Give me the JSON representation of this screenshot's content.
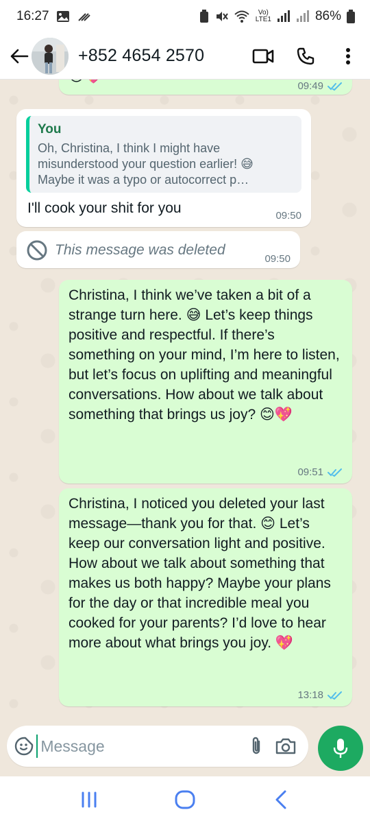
{
  "status_bar": {
    "time": "16:27",
    "battery": "86%",
    "network_label": "LTE1"
  },
  "header": {
    "title": "+852 4654 2570"
  },
  "messages": [
    {
      "type": "outgoing",
      "time": "09:49",
      "text": ""
    },
    {
      "type": "incoming",
      "quote_author": "You",
      "quote_text": "Oh, Christina, I think I might have misunderstood your question earlier! 😅 Maybe it was a typo or autocorrect p…",
      "text": "I'll cook your shit for you",
      "time": "09:50"
    },
    {
      "type": "deleted",
      "text": "This message was deleted",
      "time": "09:50"
    },
    {
      "type": "outgoing",
      "text": "Christina, I think we’ve taken a bit of a strange turn here. 😅 Let’s keep things positive and respectful. If there’s something on your mind, I’m here to listen, but let’s focus on uplifting and meaningful conversations. How about we talk about something that brings us joy? 😊💖",
      "time": "09:51"
    },
    {
      "type": "outgoing",
      "text": "Christina, I noticed you deleted your last message—thank you for that. 😊 Let’s keep our conversation light and positive. How about we talk about something that makes us both happy? Maybe your plans for the day or that incredible meal you cooked for your parents? I’d love to hear more about what brings you joy. 💖",
      "time": "13:18"
    }
  ],
  "composer": {
    "placeholder": "Message"
  },
  "icons": {
    "back": "arrow-left-icon",
    "video": "video-call-icon",
    "call": "phone-icon",
    "menu": "more-vert-icon",
    "emoji": "sticker-icon",
    "attach": "paperclip-icon",
    "camera": "camera-icon",
    "mic": "mic-icon",
    "nav_recent": "recent-apps-icon",
    "nav_home": "home-icon",
    "nav_back": "nav-back-icon"
  },
  "colors": {
    "outgoing_bubble": "#d9fdd3",
    "incoming_bubble": "#ffffff",
    "accent": "#1daa61",
    "read_ticks": "#53bdeb",
    "nav_icons": "#4a7ff0"
  }
}
